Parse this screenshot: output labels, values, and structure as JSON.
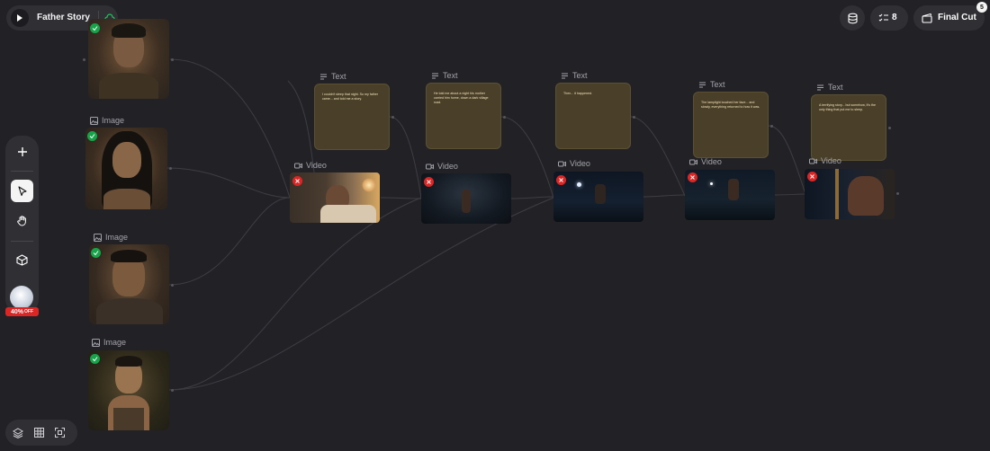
{
  "project": {
    "title": "Father Story"
  },
  "topbar": {
    "task_count": "8",
    "final_cut_label": "Final Cut",
    "notification_count": "5"
  },
  "toolbar": {
    "promo_badge_pct": "40%",
    "promo_badge_off": "OFF"
  },
  "labels": {
    "image": "Image",
    "text": "Text",
    "video": "Video"
  },
  "text_nodes": [
    "I couldn't sleep that night. So my father came... and told me a story.",
    "He told me about a night his mother carried him home, down a dark village road.",
    "Then... it happened.",
    "The lamplight touched her face... and slowly, everything returned to how it was.",
    "A terrifying story... but somehow, it's the only thing that put me to sleep."
  ],
  "colors": {
    "canvas": "#222226",
    "text_node": "#4a3f29",
    "badge_ok": "#16a34a",
    "badge_error": "#dc2626",
    "promo": "#dc2626"
  }
}
